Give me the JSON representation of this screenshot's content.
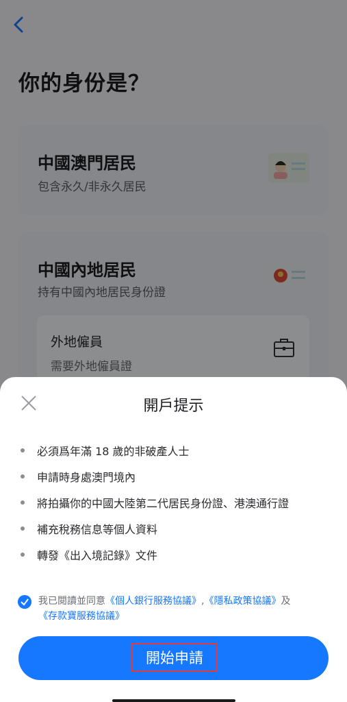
{
  "page": {
    "title": "你的身份是？",
    "cards": [
      {
        "title": "中國澳門居民",
        "subtitle": "包含永久/非永久居民"
      },
      {
        "title": "中國內地居民",
        "subtitle": "持有中國內地居民身份證",
        "sub_option": {
          "title": "外地僱員",
          "subtitle": "需要外地僱員證"
        }
      }
    ]
  },
  "sheet": {
    "title": "開戶提示",
    "items": [
      "必須爲年滿 18 歲的非破產人士",
      "申請時身處澳門境內",
      "將拍攝你的中國大陸第二代居民身份證、港澳通行證",
      "補充稅務信息等個人資料",
      "轉發《出入境記錄》文件"
    ],
    "agreement": {
      "prefix": "我已閱讀並同意",
      "link1": "《個人銀行服務協議》",
      "sep": ",",
      "link2": "《隱私政策協議》",
      "and": "及",
      "link3": "《存款寶服務協議》"
    },
    "button_label": "開始申請"
  },
  "colors": {
    "accent": "#1677ff",
    "highlight": "#e23b3b"
  }
}
